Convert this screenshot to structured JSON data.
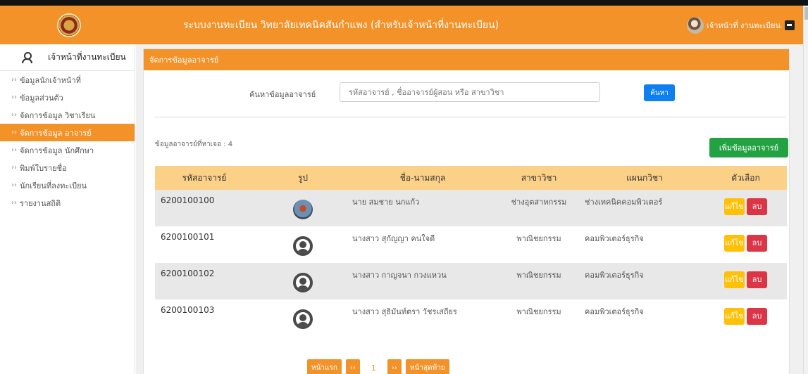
{
  "header": {
    "title": "ระบบงานทะเบียน วิทยาลัยเทคนิคสันกำแพง (สำหรับเจ้าหน้าที่งานทะเบียน)",
    "user_label": "เจ้าหน้าที่ งานทะเบียน"
  },
  "sidebar": {
    "user_label": "เจ้าหน้าที่งานทะเบียน",
    "items": [
      {
        "label": "ข้อมูลนักเจ้าหน้าที่",
        "active": false
      },
      {
        "label": "ข้อมูลส่วนตัว",
        "active": false
      },
      {
        "label": "จัดการข้อมูล วิชาเรียน",
        "active": false
      },
      {
        "label": "จัดการข้อมูล อาจารย์",
        "active": true
      },
      {
        "label": "จัดการข้อมูล นักศึกษา",
        "active": false
      },
      {
        "label": "พิมพ์ใบรายชื่อ",
        "active": false
      },
      {
        "label": "นักเรียนที่ลงทะเบียน",
        "active": false
      },
      {
        "label": "รายงานสถิติ",
        "active": false
      }
    ],
    "chevron": "››"
  },
  "panel": {
    "title": "จัดการข้อมูลอาจารย์",
    "search_label": "ค้นหาข้อมูลอาจารย์",
    "search_placeholder": "รหัสอาจารย์ , ชื่ออาจารย์ผู้สอน หรือ สาขาวิชา",
    "search_button": "ค้นหา",
    "found_text": "ข้อมูลอาจารย์ที่หาเจอ : 4",
    "add_button": "เพิ่มข้อมูลอาจารย์"
  },
  "table": {
    "headers": [
      "รหัสอาจารย์",
      "รูป",
      "ชื่อ-นามสกุล",
      "สาขาวิชา",
      "แผนกวิชา",
      "ตัวเลือก"
    ],
    "rows": [
      {
        "code": "6200100100",
        "photo": "photo",
        "name": "นาย สมชาย นกแก้ว",
        "branch": "ช่างอุตสาหกรรม",
        "dept": "ช่างเทคนิคคอมพิวเตอร์"
      },
      {
        "code": "6200100101",
        "photo": "default",
        "name": "นางสาว สุกัญญา คนใจดี",
        "branch": "พาณิชยกรรม",
        "dept": "คอมพิวเตอร์ธุรกิจ"
      },
      {
        "code": "6200100102",
        "photo": "default",
        "name": "นางสาว กาญจนา กวงแหวน",
        "branch": "พาณิชยกรรม",
        "dept": "คอมพิวเตอร์ธุรกิจ"
      },
      {
        "code": "6200100103",
        "photo": "default",
        "name": "นางสาว สุธิมันท์ตรา วัชรเสถียร",
        "branch": "พาณิชยกรรม",
        "dept": "คอมพิวเตอร์ธุรกิจ"
      }
    ],
    "edit_label": "แก้ไข",
    "delete_label": "ลบ"
  },
  "pager": {
    "first": "หน้าแรก",
    "prev": "‹‹",
    "current": "1",
    "next": "››",
    "last": "หน้าสุดท้าย"
  },
  "colors": {
    "brand_orange": "#f39228",
    "table_header": "#fbd087",
    "search_blue": "#0d7ff0",
    "add_green": "#23a243",
    "edit_yellow": "#ffc107",
    "delete_red": "#dc3545"
  }
}
